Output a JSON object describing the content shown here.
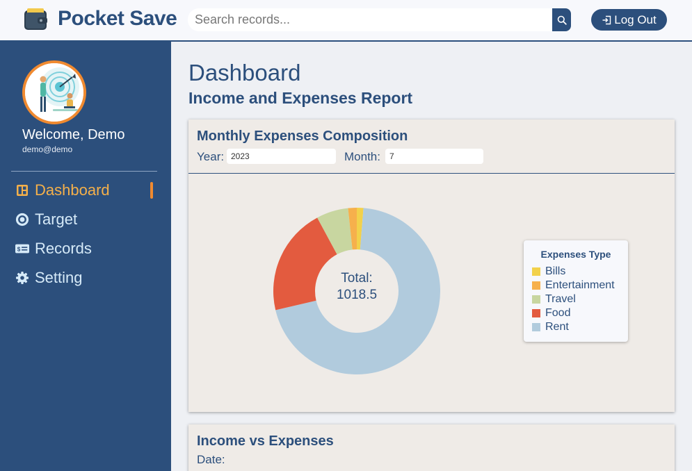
{
  "header": {
    "app_title": "Pocket Save",
    "search_placeholder": "Search records...",
    "logout_label": "Log Out"
  },
  "sidebar": {
    "welcome": "Welcome, Demo",
    "email": "demo@demo",
    "items": [
      {
        "label": "Dashboard",
        "icon": "dashboard-icon",
        "active": true
      },
      {
        "label": "Target",
        "icon": "target-icon",
        "active": false
      },
      {
        "label": "Records",
        "icon": "records-icon",
        "active": false
      },
      {
        "label": "Setting",
        "icon": "gear-icon",
        "active": false
      }
    ]
  },
  "main": {
    "title": "Dashboard",
    "subtitle": "Income and Expenses Report",
    "composition_card": {
      "title": "Monthly Expenses Composition",
      "year_label": "Year:",
      "year_value": "2023",
      "month_label": "Month:",
      "month_value": "7"
    },
    "income_card": {
      "title": "Income vs Expenses",
      "date_label": "Date:"
    }
  },
  "colors": {
    "primary": "#2c4f7c",
    "accent": "#f08a30",
    "card_bg": "#efebe7"
  },
  "chart_data": {
    "type": "pie",
    "title": "",
    "center_label": "Total:",
    "center_value": "1018.5",
    "legend_title": "Expenses Type",
    "legend_position": "right",
    "categories": [
      "Bills",
      "Entertainment",
      "Travel",
      "Food",
      "Rent"
    ],
    "values": [
      13,
      17,
      63,
      212,
      713.5
    ],
    "colors": [
      "#f2d14b",
      "#f6b04c",
      "#c8d6a0",
      "#e35b3f",
      "#b1cbdd"
    ]
  }
}
